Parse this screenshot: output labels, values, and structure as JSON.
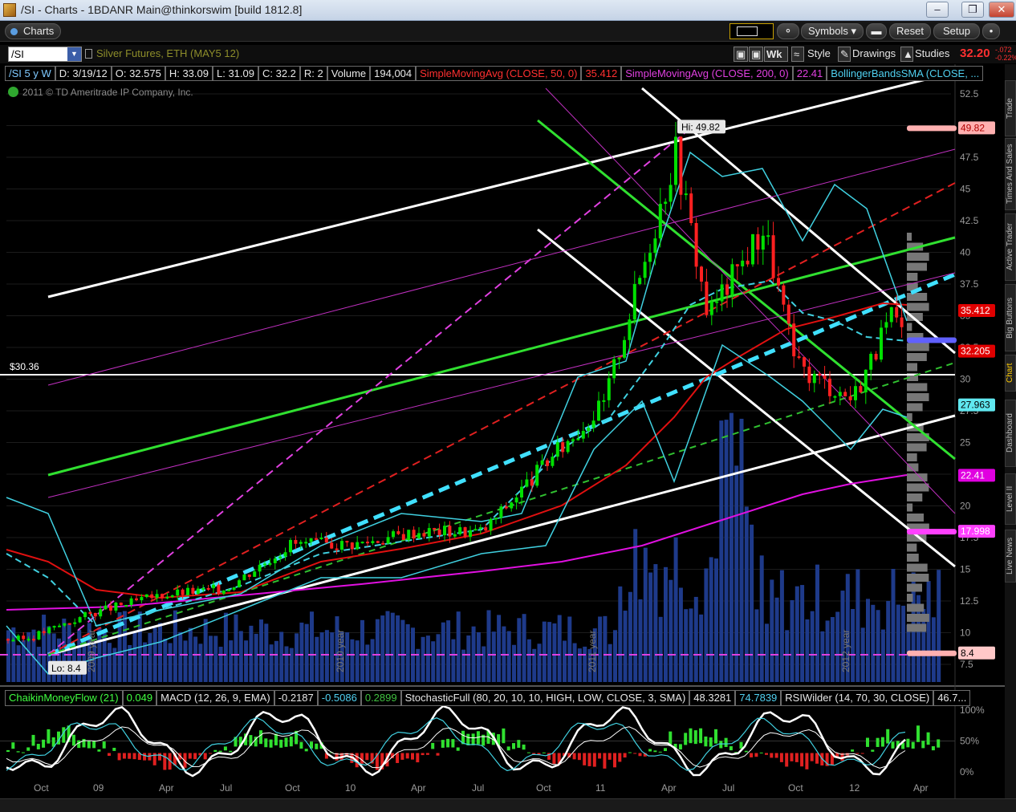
{
  "window": {
    "title": "/SI - Charts - 1BDANR Main@thinkorswim [build 1812.8]"
  },
  "toolbar": {
    "charts_tab": "Charts",
    "symbols_label": "Symbols",
    "reset_label": "Reset",
    "setup_label": "Setup"
  },
  "symbol_bar": {
    "symbol": "/SI",
    "description": "Silver Futures, ETH (MAY5 12)",
    "wk_label": "Wk",
    "style_label": "Style",
    "drawings_label": "Drawings",
    "studies_label": "Studies",
    "last_price": "32.20",
    "change_abs": "-.072",
    "change_pct": "-0.22%"
  },
  "info_strip": {
    "period": "/SI 5 y W",
    "date": "D: 3/19/12",
    "open": "O: 32.575",
    "high": "H: 33.09",
    "low": "L: 31.09",
    "close": "C: 32.2",
    "range": "R: 2",
    "volume_label": "Volume",
    "volume_value": "194,004",
    "sma50": "SimpleMovingAvg (CLOSE, 50, 0)",
    "sma50_value": "35.412",
    "sma200": "SimpleMovingAvg (CLOSE, 200, 0)",
    "sma200_value": "22.41",
    "bollinger": "BollingerBandsSMA (CLOSE, ..."
  },
  "copyright": "2011 © TD Ameritrade IP Company, Inc.",
  "price_chart": {
    "hi_label": "Hi: 49.82",
    "lo_label": "Lo: 8.4",
    "hline_label": "$30.36",
    "y_ticks": [
      "52.5",
      "50",
      "47.5",
      "45",
      "42.5",
      "40",
      "37.5",
      "35",
      "32.5",
      "30",
      "27.5",
      "25",
      "22.5",
      "20",
      "17.5",
      "15",
      "12.5",
      "10",
      "7.5"
    ],
    "y_tick_values": [
      52.5,
      50,
      47.5,
      45,
      42.5,
      40,
      37.5,
      35,
      32.5,
      30,
      27.5,
      25,
      22.5,
      20,
      17.5,
      15,
      12.5,
      10,
      7.5
    ],
    "price_tags": [
      {
        "text": "49.82",
        "value": 49.82,
        "bg": "#ffb0b0",
        "fg": "#b00000"
      },
      {
        "text": "35.412",
        "value": 35.412,
        "bg": "#e00000",
        "fg": "#ffffff"
      },
      {
        "text": "32.205",
        "value": 32.205,
        "bg": "#e00000",
        "fg": "#ffffff"
      },
      {
        "text": "27.963",
        "value": 27.963,
        "bg": "#60e8f0",
        "fg": "#000000"
      },
      {
        "text": "22.41",
        "value": 22.41,
        "bg": "#e000e0",
        "fg": "#ffffff"
      },
      {
        "text": "17.998",
        "value": 17.998,
        "bg": "#ff40ff",
        "fg": "#ffffff"
      },
      {
        "text": "8.4",
        "value": 8.4,
        "bg": "#ffc8c8",
        "fg": "#000000"
      }
    ],
    "year_marks": [
      "2009 year",
      "2010 year",
      "2011 year",
      "2012 year"
    ],
    "x_ticks": [
      "Oct",
      "09",
      "Apr",
      "Jul",
      "Oct",
      "10",
      "Apr",
      "Jul",
      "Oct",
      "11",
      "Apr",
      "Jul",
      "Oct",
      "12",
      "Apr"
    ]
  },
  "lower_studies": {
    "cmf": "ChaikinMoneyFlow (21)",
    "cmf_value": "0.049",
    "macd": "MACD (12, 26, 9, EMA)",
    "macd_v1": "-0.2187",
    "macd_v2": "-0.5086",
    "macd_v3": "0.2899",
    "stoch": "StochasticFull (80, 20, 10, 10, HIGH, LOW, CLOSE, 3, SMA)",
    "stoch_v1": "48.3281",
    "stoch_v2": "74.7839",
    "rsi": "RSIWilder (14, 70, 30, CLOSE)",
    "rsi_value": "46.7...",
    "y_ticks": [
      "100%",
      "50%",
      "0%"
    ]
  },
  "sidebar_tabs": [
    "Trade",
    "Times And Sales",
    "Active Trader",
    "Big Buttons",
    "Chart",
    "Dashboard",
    "Level II",
    "Live News"
  ],
  "colors": {
    "candle_up": "#00e000",
    "candle_down": "#ff2020",
    "volume": "#1e3a8a",
    "sma50": "#e01010",
    "sma200": "#e010e0",
    "bollinger": "#40d0e0",
    "trend_cyan": "#40e0ff"
  },
  "chart_data": {
    "type": "candlestick",
    "title": "/SI 5 y W",
    "period": "weekly",
    "x_range": [
      "2008-09",
      "2012-03"
    ],
    "ylim": [
      7.5,
      52.5
    ],
    "high_marker": 49.82,
    "low_marker": 8.4,
    "horizontal_line": 30.36,
    "last": {
      "date": "3/19/12",
      "open": 32.575,
      "high": 33.09,
      "low": 31.09,
      "close": 32.2
    },
    "price_path_approx": [
      {
        "x": "2008-Oct",
        "y": 9.5
      },
      {
        "x": "2009-Jan",
        "y": 11.5
      },
      {
        "x": "2009-Apr",
        "y": 13.0
      },
      {
        "x": "2009-Jul",
        "y": 13.5
      },
      {
        "x": "2009-Oct",
        "y": 17.0
      },
      {
        "x": "2010-Jan",
        "y": 17.0
      },
      {
        "x": "2010-Apr",
        "y": 18.0
      },
      {
        "x": "2010-Jul",
        "y": 18.0
      },
      {
        "x": "2010-Oct",
        "y": 23.5
      },
      {
        "x": "2011-Jan",
        "y": 28.0
      },
      {
        "x": "2011-Apr",
        "y": 48.0
      },
      {
        "x": "2011-Jun",
        "y": 35.0
      },
      {
        "x": "2011-Aug",
        "y": 42.0
      },
      {
        "x": "2011-Oct",
        "y": 31.0
      },
      {
        "x": "2011-Dec",
        "y": 28.5
      },
      {
        "x": "2012-Feb",
        "y": 35.0
      },
      {
        "x": "2012-Mar",
        "y": 32.2
      }
    ]
  }
}
